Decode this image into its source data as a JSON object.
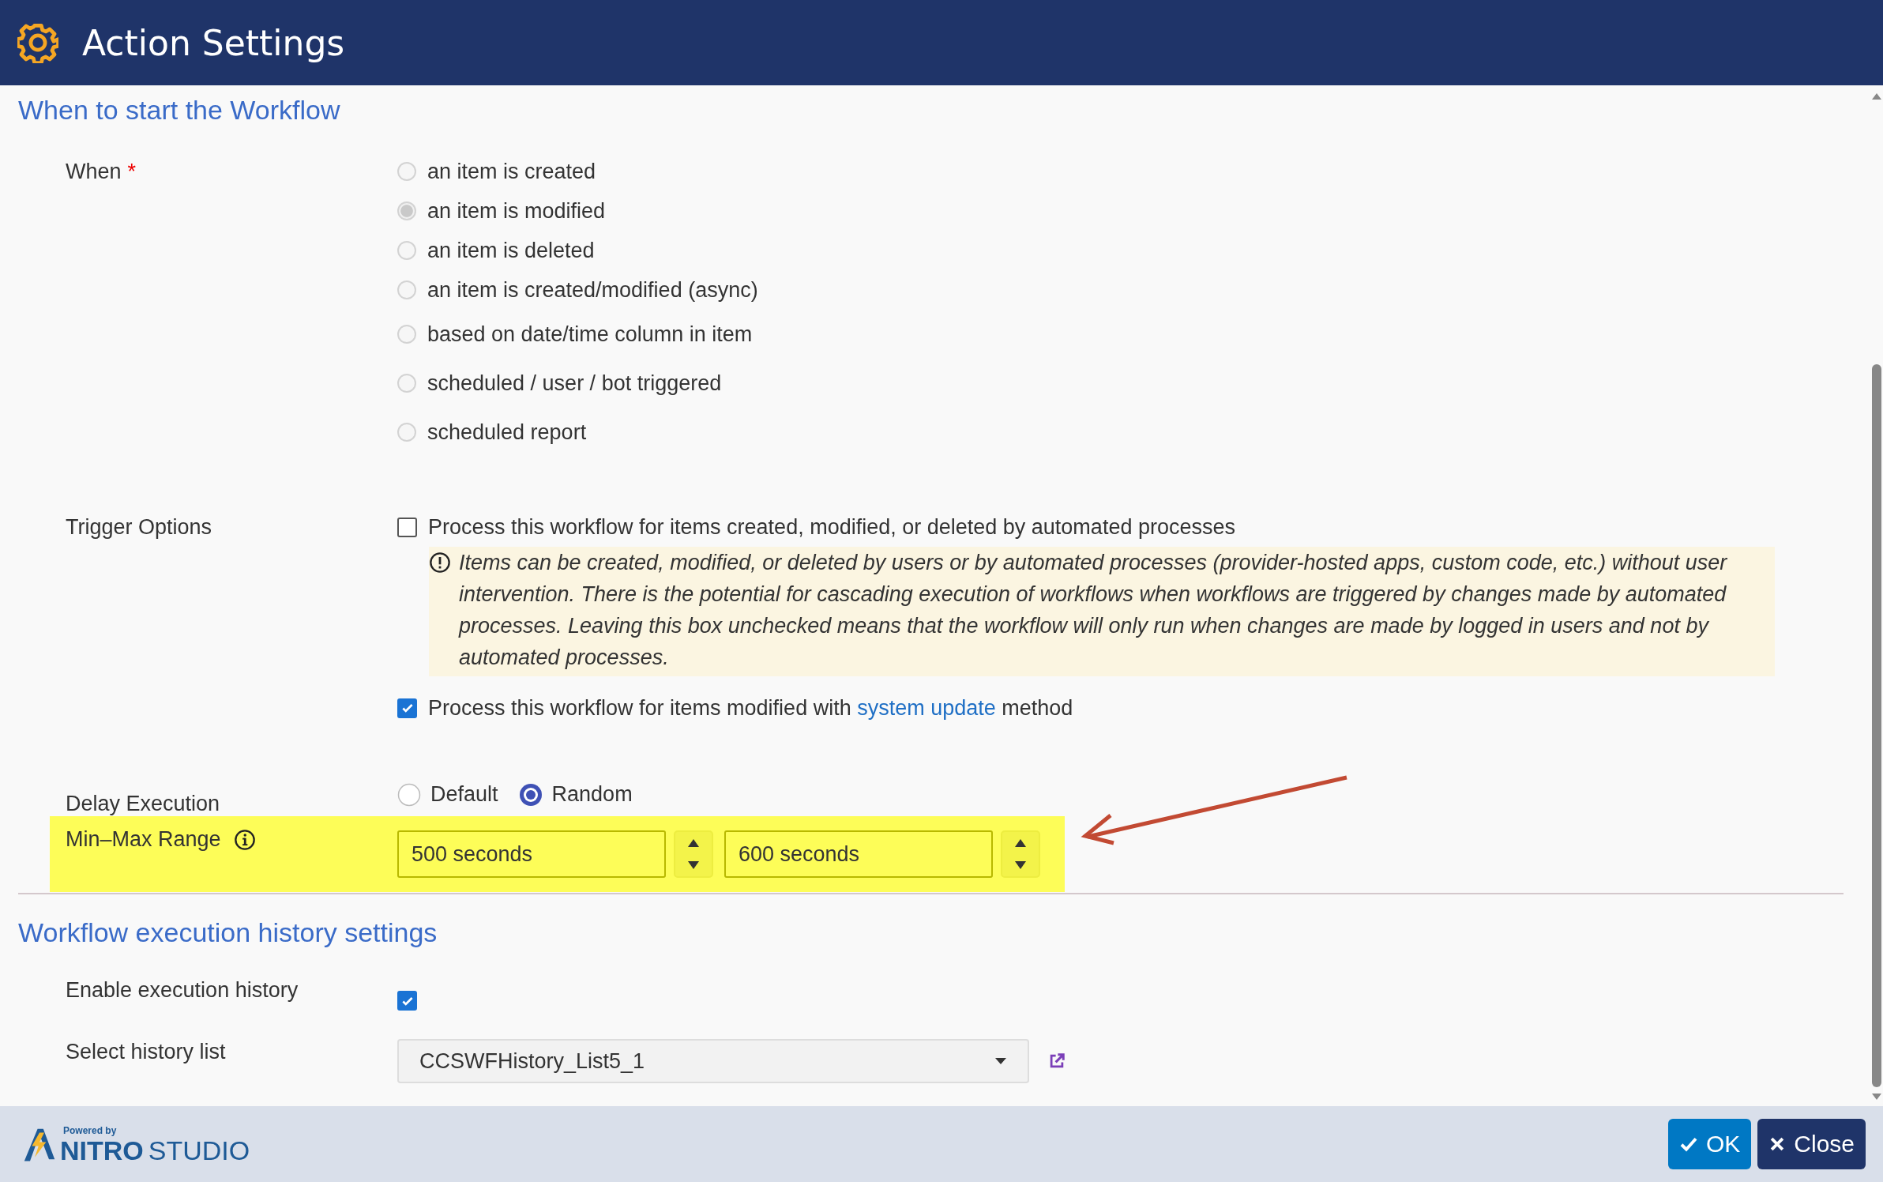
{
  "header": {
    "title": "Action Settings"
  },
  "start_section": {
    "heading": "When to start the Workflow",
    "when": {
      "label": "When",
      "required_mark": "*",
      "disabled": true,
      "options": [
        {
          "label": "an item is created",
          "selected": false
        },
        {
          "label": "an item is modified",
          "selected": true
        },
        {
          "label": "an item is deleted",
          "selected": false
        },
        {
          "label": "an item is created/modified (async)",
          "selected": false
        },
        {
          "label": "based on date/time column in item",
          "selected": false
        },
        {
          "label": "scheduled / user / bot triggered",
          "selected": false
        },
        {
          "label": "scheduled report",
          "selected": false
        }
      ]
    },
    "trigger_options": {
      "label": "Trigger Options",
      "automated": {
        "label": "Process this workflow for items created, modified, or deleted by automated processes",
        "checked": false
      },
      "note": "Items can be created, modified, or deleted by users or by automated processes (provider-hosted apps, custom code, etc.) without user intervention. There is the potential for cascading execution of workflows when workflows are triggered by changes made by automated processes. Leaving this box unchecked means that the workflow will only run when changes are made by logged in users and not by automated processes.",
      "system_update": {
        "before": "Process this workflow for items modified with",
        "link": "system update",
        "after": "method",
        "checked": true
      }
    },
    "delay": {
      "label": "Delay Execution",
      "options": [
        {
          "label": "Default",
          "selected": false
        },
        {
          "label": "Random",
          "selected": true
        }
      ]
    },
    "range": {
      "label": "Min–Max Range",
      "highlighted": true,
      "min": "500 seconds",
      "max": "600 seconds"
    }
  },
  "history_section": {
    "heading": "Workflow execution history settings",
    "enable": {
      "label": "Enable execution history",
      "checked": true
    },
    "list": {
      "label": "Select history list",
      "value": "CCSWFHistory_List5_1"
    }
  },
  "footer": {
    "powered_by": "Powered by",
    "brand_bold": "NITRO",
    "brand": "STUDIO",
    "buttons": [
      {
        "label": "OK",
        "kind": "primary"
      },
      {
        "label": "Close",
        "kind": "secondary"
      }
    ]
  }
}
